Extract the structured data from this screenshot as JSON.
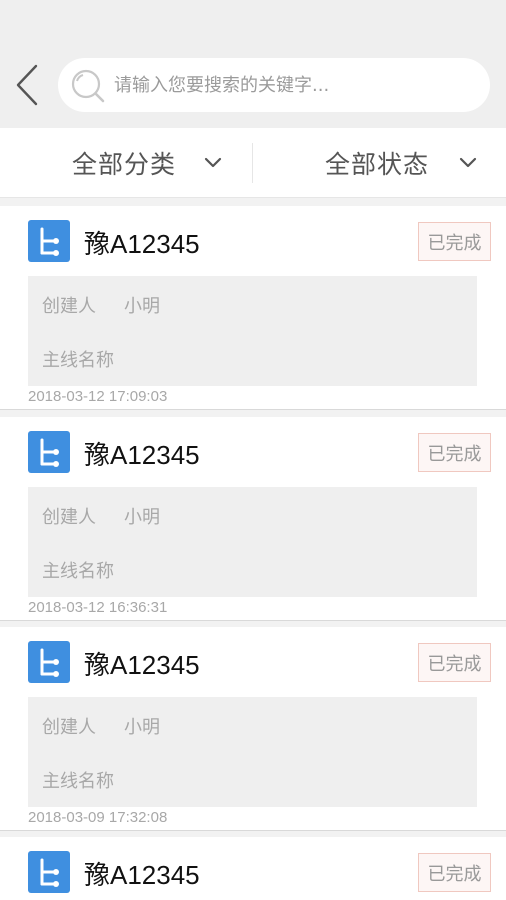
{
  "search": {
    "placeholder": "请输入您要搜索的关键字..."
  },
  "filters": {
    "category_label": "全部分类",
    "status_label": "全部状态"
  },
  "records": [
    {
      "title": "豫A12345",
      "status": "已完成",
      "creator_key": "创建人",
      "creator_value": "小明",
      "line_key": "主线名称",
      "time": "2018-03-12 17:09:03"
    },
    {
      "title": "豫A12345",
      "status": "已完成",
      "creator_key": "创建人",
      "creator_value": "小明",
      "line_key": "主线名称",
      "time": "2018-03-12 16:36:31"
    },
    {
      "title": "豫A12345",
      "status": "已完成",
      "creator_key": "创建人",
      "creator_value": "小明",
      "line_key": "主线名称",
      "time": "2018-03-09 17:32:08"
    },
    {
      "title": "豫A12345",
      "status": "已完成"
    }
  ],
  "colors": {
    "icon_blue": "#3f8fe0",
    "badge_border": "#f0c8c0"
  },
  "icons": {
    "back": "chevron-left-icon",
    "search": "search-icon",
    "dropdown": "chevron-down-icon",
    "record": "route-branch-icon"
  }
}
